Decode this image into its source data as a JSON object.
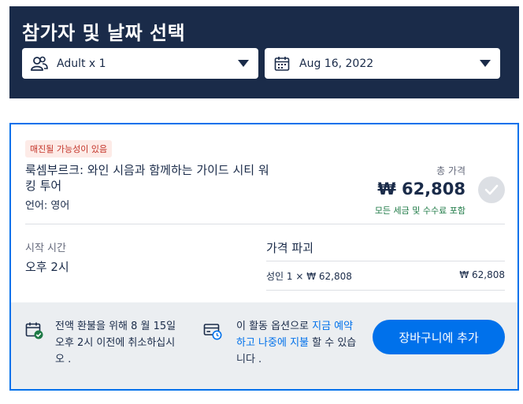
{
  "header": {
    "title": "참가자 및 날짜 선택",
    "participants": "Adult x 1",
    "date": "Aug 16, 2022"
  },
  "activity": {
    "availability_badge": "매진될 가능성이 있음",
    "title": "룩셈부르크: 와인 시음과 함께하는 가이드 시티 워킹 투어",
    "language": "언어: 영어",
    "total_price_label": "총 가격",
    "total_price": "₩ 62,808",
    "price_note": "모든 세금 및 수수료 포함",
    "start_time_label": "시작 시간",
    "start_time": "오후 2시",
    "price_breakdown_title": "가격 파괴",
    "breakdown_rows": [
      {
        "label": "성인 1 × ₩ 62,808",
        "value": "₩ 62,808"
      }
    ]
  },
  "footer": {
    "refund_text": "전액 환불을 위해 8 월 15일 오후 2시 이전에 취소하십시오 .",
    "reserve_text_before": "이 활동 옵션으로 ",
    "reserve_link": "지금 예약하고 나중에 지불",
    "reserve_text_after": " 할 수 있습니다 .",
    "add_to_cart": "장바구니에 추가"
  },
  "colors": {
    "navy": "#1a2b49",
    "accent": "#0071eb",
    "badge_bg": "#fdebe7",
    "badge_text": "#c4352a",
    "included_note": "#1e7a46",
    "footer_bg": "#ebeef1"
  },
  "icons": {
    "participants": "people-icon",
    "date": "calendar-icon",
    "selected": "check-icon",
    "refund": "calendar-check-icon",
    "reserve": "card-clock-icon"
  }
}
